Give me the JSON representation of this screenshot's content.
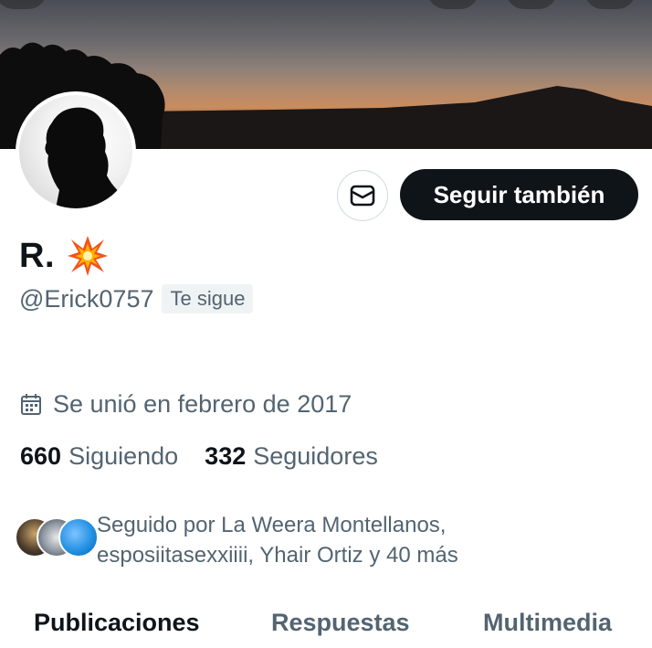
{
  "profile": {
    "name": "R.",
    "name_emoji": "💥",
    "handle": "@Erick0757",
    "follows_you_label": "Te sigue",
    "joined": "Se unió en febrero de 2017"
  },
  "actions": {
    "follow_back_label": "Seguir también",
    "message_icon": "envelope-icon"
  },
  "stats": {
    "following_count": "660",
    "following_label": "Siguiendo",
    "followers_count": "332",
    "followers_label": "Seguidores"
  },
  "followed_by": {
    "text": "Seguido por La Weera Montellanos, esposiitasexxiiii, Yhair Ortiz y 40 más"
  },
  "tabs": [
    {
      "label": "Publicaciones",
      "active": true
    },
    {
      "label": "Respuestas",
      "active": false
    },
    {
      "label": "Multimedia",
      "active": false
    }
  ],
  "colors": {
    "primary_text": "#0f1419",
    "secondary_text": "#536471",
    "button_dark": "#0f1419",
    "border": "#cfd9de"
  }
}
